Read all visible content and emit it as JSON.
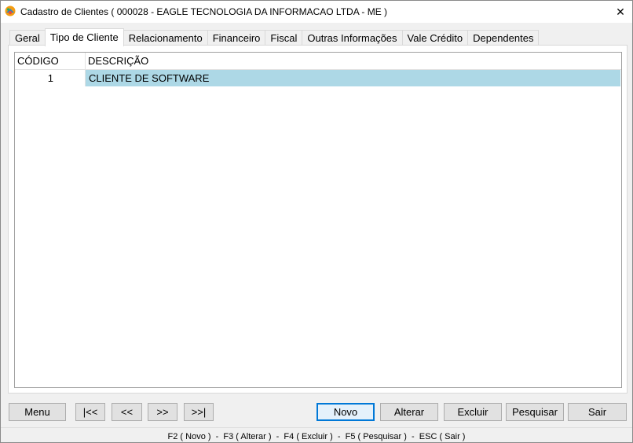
{
  "window": {
    "title": "Cadastro de Clientes ( 000028 - EAGLE TECNOLOGIA DA INFORMACAO LTDA - ME )",
    "close_glyph": "✕"
  },
  "tabs": [
    {
      "label": "Geral"
    },
    {
      "label": "Tipo de Cliente",
      "active": true
    },
    {
      "label": "Relacionamento"
    },
    {
      "label": "Financeiro"
    },
    {
      "label": "Fiscal"
    },
    {
      "label": "Outras Informações"
    },
    {
      "label": "Vale Crédito"
    },
    {
      "label": "Dependentes"
    }
  ],
  "grid": {
    "columns": {
      "code": "CÓDIGO",
      "description": "DESCRIÇÃO"
    },
    "rows": [
      {
        "code": "1",
        "description": "CLIENTE DE SOFTWARE",
        "selected": true
      }
    ],
    "selected_color": "#add8e6"
  },
  "buttons": {
    "menu": "Menu",
    "first": "|<<",
    "prev": "<<",
    "next": ">>",
    "last": ">>|",
    "novo": "Novo",
    "alterar": "Alterar",
    "excluir": "Excluir",
    "pesquisar": "Pesquisar",
    "sair": "Sair"
  },
  "statusbar": {
    "shortcuts": "F2 ( Novo )  -  F3 ( Alterar )  -  F4 ( Excluir )  -  F5 ( Pesquisar )  -  ESC ( Sair )"
  },
  "icons": {
    "app": "app-logo-icon",
    "close": "close-icon"
  }
}
